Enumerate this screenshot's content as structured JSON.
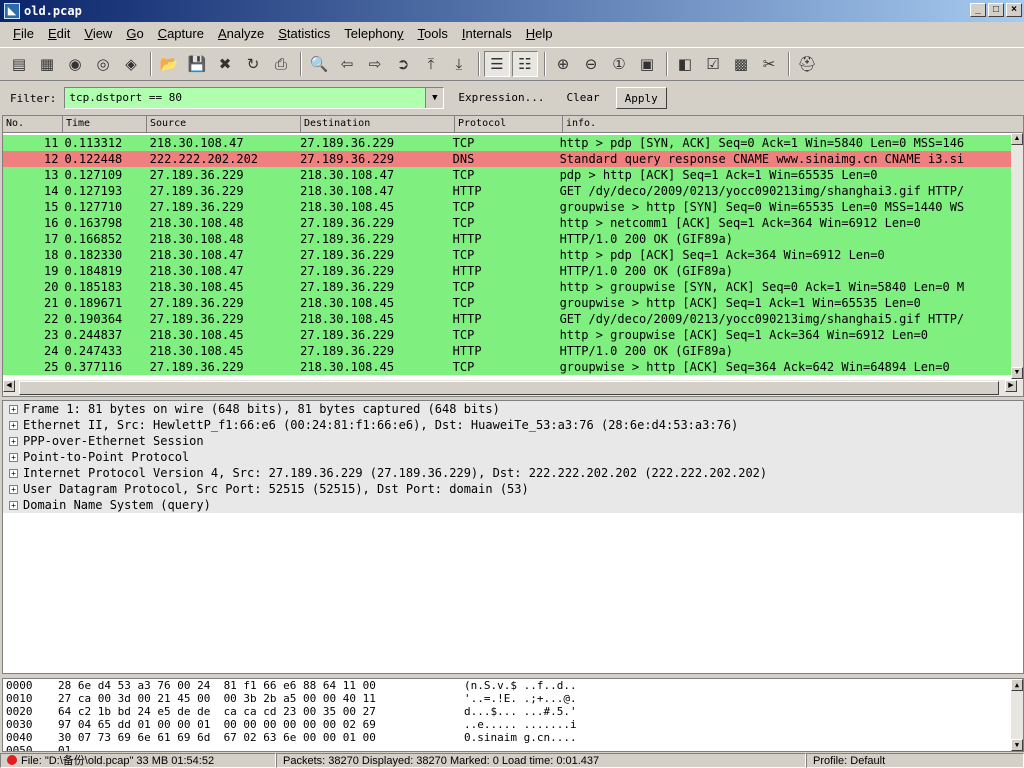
{
  "window": {
    "title": "old.pcap"
  },
  "menu": [
    {
      "label": "File",
      "accel": "F"
    },
    {
      "label": "Edit",
      "accel": "E"
    },
    {
      "label": "View",
      "accel": "V"
    },
    {
      "label": "Go",
      "accel": "G"
    },
    {
      "label": "Capture",
      "accel": "C"
    },
    {
      "label": "Analyze",
      "accel": "A"
    },
    {
      "label": "Statistics",
      "accel": "S"
    },
    {
      "label": "Telephony",
      "accel": "y"
    },
    {
      "label": "Tools",
      "accel": "T"
    },
    {
      "label": "Internals",
      "accel": "I"
    },
    {
      "label": "Help",
      "accel": "H"
    }
  ],
  "toolbar": {
    "icons": [
      "interfaces-icon",
      "options-icon",
      "start-capture-icon",
      "stop-capture-icon",
      "restart-capture-icon",
      "open-icon",
      "save-icon",
      "close-icon",
      "reload-icon",
      "print-icon",
      "find-icon",
      "back-icon",
      "forward-icon",
      "goto-icon",
      "first-packet-icon",
      "last-packet-icon",
      "colorize-icon",
      "autoscroll-icon",
      "zoom-in-icon",
      "zoom-out-icon",
      "normal-size-icon",
      "resize-columns-icon",
      "capture-filters-icon",
      "display-filters-icon",
      "coloring-rules-icon",
      "preferences-icon",
      "help-icon"
    ]
  },
  "filter": {
    "label": "Filter:",
    "value": "tcp.dstport == 80",
    "expression": "Expression...",
    "clear": "Clear",
    "apply": "Apply"
  },
  "columns": [
    "No.",
    "Time",
    "Source",
    "Destination",
    "Protocol",
    "info."
  ],
  "packets": [
    {
      "no": "11",
      "time": "0.113312",
      "src": "218.30.108.47",
      "dst": "27.189.36.229",
      "proto": "TCP",
      "info": "http > pdp [SYN, ACK] Seq=0 Ack=1 Win=5840 Len=0 MSS=146",
      "kind": "tcp"
    },
    {
      "no": "12",
      "time": "0.122448",
      "src": "222.222.202.202",
      "dst": "27.189.36.229",
      "proto": "DNS",
      "info": "Standard query response CNAME www.sinaimg.cn CNAME i3.si",
      "kind": "dns"
    },
    {
      "no": "13",
      "time": "0.127109",
      "src": "27.189.36.229",
      "dst": "218.30.108.47",
      "proto": "TCP",
      "info": "pdp > http [ACK] Seq=1 Ack=1 Win=65535 Len=0",
      "kind": "tcp"
    },
    {
      "no": "14",
      "time": "0.127193",
      "src": "27.189.36.229",
      "dst": "218.30.108.47",
      "proto": "HTTP",
      "info": "GET /dy/deco/2009/0213/yocc090213img/shanghai3.gif HTTP/",
      "kind": "tcp"
    },
    {
      "no": "15",
      "time": "0.127710",
      "src": "27.189.36.229",
      "dst": "218.30.108.45",
      "proto": "TCP",
      "info": "groupwise > http [SYN] Seq=0 Win=65535 Len=0 MSS=1440 WS",
      "kind": "tcp"
    },
    {
      "no": "16",
      "time": "0.163798",
      "src": "218.30.108.48",
      "dst": "27.189.36.229",
      "proto": "TCP",
      "info": "http > netcomm1 [ACK] Seq=1 Ack=364 Win=6912 Len=0",
      "kind": "tcp"
    },
    {
      "no": "17",
      "time": "0.166852",
      "src": "218.30.108.48",
      "dst": "27.189.36.229",
      "proto": "HTTP",
      "info": "HTTP/1.0 200 OK  (GIF89a)",
      "kind": "tcp"
    },
    {
      "no": "18",
      "time": "0.182330",
      "src": "218.30.108.47",
      "dst": "27.189.36.229",
      "proto": "TCP",
      "info": "http > pdp [ACK] Seq=1 Ack=364 Win=6912 Len=0",
      "kind": "tcp"
    },
    {
      "no": "19",
      "time": "0.184819",
      "src": "218.30.108.47",
      "dst": "27.189.36.229",
      "proto": "HTTP",
      "info": "HTTP/1.0 200 OK  (GIF89a)",
      "kind": "tcp"
    },
    {
      "no": "20",
      "time": "0.185183",
      "src": "218.30.108.45",
      "dst": "27.189.36.229",
      "proto": "TCP",
      "info": "http > groupwise [SYN, ACK] Seq=0 Ack=1 Win=5840 Len=0 M",
      "kind": "tcp"
    },
    {
      "no": "21",
      "time": "0.189671",
      "src": "27.189.36.229",
      "dst": "218.30.108.45",
      "proto": "TCP",
      "info": "groupwise > http [ACK] Seq=1 Ack=1 Win=65535 Len=0",
      "kind": "tcp"
    },
    {
      "no": "22",
      "time": "0.190364",
      "src": "27.189.36.229",
      "dst": "218.30.108.45",
      "proto": "HTTP",
      "info": "GET /dy/deco/2009/0213/yocc090213img/shanghai5.gif HTTP/",
      "kind": "tcp"
    },
    {
      "no": "23",
      "time": "0.244837",
      "src": "218.30.108.45",
      "dst": "27.189.36.229",
      "proto": "TCP",
      "info": "http > groupwise [ACK] Seq=1 Ack=364 Win=6912 Len=0",
      "kind": "tcp"
    },
    {
      "no": "24",
      "time": "0.247433",
      "src": "218.30.108.45",
      "dst": "27.189.36.229",
      "proto": "HTTP",
      "info": "HTTP/1.0 200 OK  (GIF89a)",
      "kind": "tcp"
    },
    {
      "no": "25",
      "time": "0.377116",
      "src": "27.189.36.229",
      "dst": "218.30.108.45",
      "proto": "TCP",
      "info": "groupwise > http [ACK] Seq=364 Ack=642 Win=64894 Len=0",
      "kind": "tcp"
    }
  ],
  "details": [
    "Frame 1: 81 bytes on wire (648 bits), 81 bytes captured (648 bits)",
    "Ethernet II, Src: HewlettP_f1:66:e6 (00:24:81:f1:66:e6), Dst: HuaweiTe_53:a3:76 (28:6e:d4:53:a3:76)",
    "PPP-over-Ethernet Session",
    "Point-to-Point Protocol",
    "Internet Protocol Version 4, Src: 27.189.36.229 (27.189.36.229), Dst: 222.222.202.202 (222.222.202.202)",
    "User Datagram Protocol, Src Port: 52515 (52515), Dst Port: domain (53)",
    "Domain Name System (query)"
  ],
  "hex": [
    {
      "off": "0000",
      "bytes": "28 6e d4 53 a3 76 00 24  81 f1 66 e6 88 64 11 00",
      "ascii": "(n.S.v.$ ..f..d.."
    },
    {
      "off": "0010",
      "bytes": "27 ca 00 3d 00 21 45 00  00 3b 2b a5 00 00 40 11",
      "ascii": "'..=.!E. .;+...@."
    },
    {
      "off": "0020",
      "bytes": "64 c2 1b bd 24 e5 de de  ca ca cd 23 00 35 00 27",
      "ascii": "d...$... ...#.5.'"
    },
    {
      "off": "0030",
      "bytes": "97 04 65 dd 01 00 00 01  00 00 00 00 00 00 02 69",
      "ascii": "..e..... .......i"
    },
    {
      "off": "0040",
      "bytes": "30 07 73 69 6e 61 69 6d  67 02 63 6e 00 00 01 00",
      "ascii": "0.sinaim g.cn...."
    },
    {
      "off": "0050",
      "bytes": "01",
      "ascii": ""
    }
  ],
  "status": {
    "file": "File: \"D:\\备份\\old.pcap\" 33 MB 01:54:52",
    "packets": "Packets: 38270 Displayed: 38270 Marked: 0 Load time: 0:01.437",
    "profile": "Profile: Default"
  },
  "colors": {
    "tcp_row": "#7ff07f",
    "dns_row": "#f08080",
    "filter_valid": "#afffaf"
  }
}
